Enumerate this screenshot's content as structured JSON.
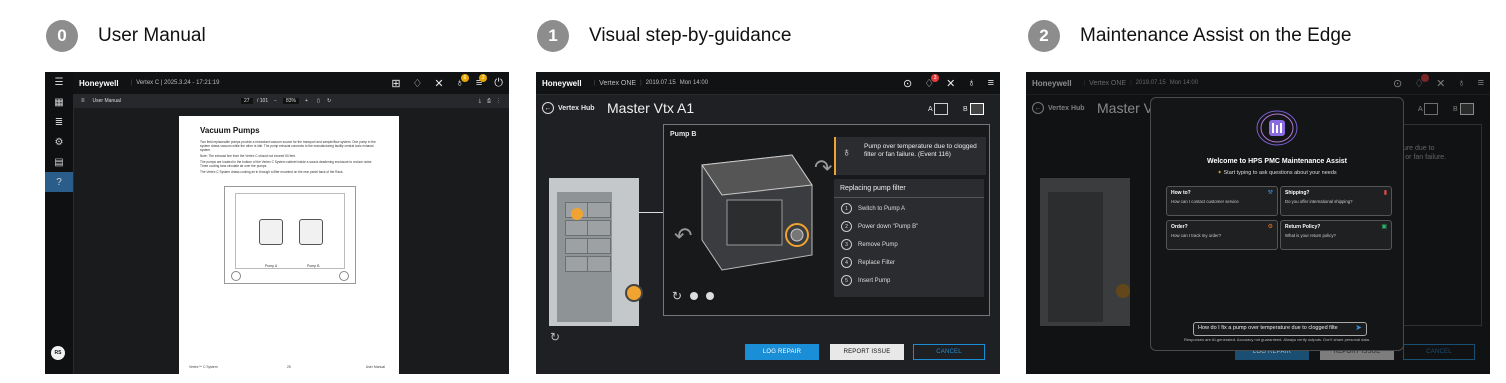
{
  "steps": [
    {
      "number": "0",
      "title": "User Manual"
    },
    {
      "number": "1",
      "title": "Visual step-by-guidance"
    },
    {
      "number": "2",
      "title": "Maintenance Assist on the Edge"
    }
  ],
  "panel0": {
    "brand": "Honeywell",
    "context": "Vertex C | 2025.3.24 - 17:21:19",
    "toolbar_title": "User Manual",
    "page_current": "27",
    "page_total": "/ 101",
    "zoom": "83%",
    "avatar": "RS",
    "doc_title": "Vacuum Pumps",
    "doc_p1": "Two field replaceable pumps provide a redundant vacuum source for the transport and sample/flow system. One pump in the system draws vacuum while the other is idle. The pump exhaust connects to the manufacturing facility central toxic exhaust system.",
    "doc_p2": "Note: The exhaust line from the Vertex C should not exceed 50 feet.",
    "doc_p3": "The pumps are located in the bottom of the Vertex C System cabinet inside a sound-deadening enclosure to reduce noise. Three cooling fans circulate air over the pumps.",
    "doc_p4": "The Vertex C System draws cooling air in through a filter mounted on the rear panel back of the Rack.",
    "label_pump_a": "Pump A",
    "label_pump_b": "Pump B",
    "footer_left": "Vertex™ C System",
    "footer_center": "25",
    "footer_right": "User Manual",
    "notif_badge": "6",
    "notif_badge2": "2"
  },
  "panel1": {
    "brand": "Honeywell",
    "context": "Vertex ONE",
    "date": "2019.07.15",
    "time": "Mon 14:00",
    "notif_badge": "3",
    "back_label": "Vertex Hub",
    "machine_title": "Master Vtx A1",
    "view_a": "A",
    "view_b": "B",
    "pump_title": "Pump B",
    "alert_text": "Pump over temperature due to clogged filter or fan failure. (Event 116)",
    "procedure_title": "Replacing pump filter",
    "procedure_steps": [
      {
        "n": "1",
        "label": "Switch to Pump A"
      },
      {
        "n": "2",
        "label": "Power down \"Pump B\""
      },
      {
        "n": "3",
        "label": "Remove Pump"
      },
      {
        "n": "4",
        "label": "Replace Filter"
      },
      {
        "n": "5",
        "label": "Insert Pump"
      }
    ],
    "btn_log": "LOG REPAIR",
    "btn_report": "REPORT ISSUE",
    "btn_cancel": "CANCEL"
  },
  "panel2": {
    "brand": "Honeywell",
    "context": "Vertex ONE",
    "date": "2019.07.15",
    "time": "Mon 14:00",
    "back_label": "Vertex Hub",
    "machine_title": "Master V",
    "view_a": "A",
    "view_b": "B",
    "bg_text1": "ture due to",
    "bg_text2": "r or fan failure.",
    "modal_title": "Welcome to HPS PMC Maintenance Assist",
    "modal_subtitle": "Start typing to ask questions about your needs",
    "cards": [
      {
        "title": "How to?",
        "body": "How can I contact customer service",
        "icon_color": "#3d8ee0"
      },
      {
        "title": "Shipping?",
        "body": "Do you offer international shipping?",
        "icon_color": "#e84a4a"
      },
      {
        "title": "Order?",
        "body": "How can I track my order?",
        "icon_color": "#e07a2a"
      },
      {
        "title": "Return Policy?",
        "body": "What is your return policy?",
        "icon_color": "#2fb36b"
      }
    ],
    "input_value": "How do I fix a pump over temperature due to clogged filte",
    "disclaimer": "Responses are AI-generated. Accuracy not guaranteed. Always verify outputs. Don't share personal data.",
    "btn_log": "LOG REPAIR",
    "btn_report": "REPORT ISSUE",
    "btn_cancel": "CANCEL"
  },
  "colors": {
    "accent_blue": "#1a8fd8",
    "warning": "#f0a330",
    "alert_red": "#e23b3b"
  }
}
